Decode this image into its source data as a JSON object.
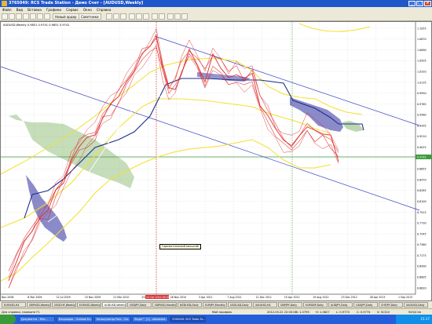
{
  "window": {
    "title": "3765049: RCS Trade Station - Демо Счет - [AUDUSD,Weekly]",
    "buttons": [
      "_",
      "□",
      "×"
    ]
  },
  "menu": [
    "Файл",
    "Вид",
    "Вставка",
    "Графики",
    "Сервис",
    "Окно",
    "Справка"
  ],
  "toolbar": {
    "new_order_label": "Новый ордер",
    "experts_label": "Советники"
  },
  "chart": {
    "indicator_label": "AUDUSD,Weekly  0.9851 0.9741 0.9851 0.9741",
    "price_labels": [
      "1.1055",
      "1.0870",
      "1.0690",
      "1.0505",
      "1.0320",
      "1.0135",
      "0.9950",
      "0.9765",
      "0.9580",
      "0.9395",
      "0.9210",
      "0.9025",
      "0.8840",
      "0.8655",
      "0.8470",
      "0.8285",
      "0.8100",
      "0.7915",
      "0.7730",
      "0.7545",
      "0.7360",
      "0.7175",
      "0.6990",
      "0.6805",
      "0.6620"
    ],
    "date_labels": [
      "9 Nov 2008",
      "8 Mar 2009",
      "12 Jul 2009",
      "15 Nov 2009",
      "21 Mar 2010",
      "25 Jul 2010",
      "28 Nov 2010",
      "3 Apr 2011",
      "7 Aug 2011",
      "11 Dec 2011",
      "15 Apr 2012",
      "19 Aug 2012",
      "23 Dec 2012",
      "28 Apr 2013",
      "1 Sep 2013"
    ],
    "highlight_date": "24 Oct 2010 00:00",
    "current_price": "0.9741",
    "tooltip": "Горизонтальный масштаб"
  },
  "tabs": [
    "EURUSD,H4",
    "GBPUSD,Weekly",
    "USDCHF,Weekly",
    "EURUSD,Weekly",
    "AUDUSD,Weekly",
    "USDJPY,Daily",
    "GBPUSD,Monthly",
    "NZDUSD,Daily",
    "EURJPY,Monthly",
    "USDCAD,Daily",
    "XAUUSD,H4",
    "GBPJPY,Daily",
    "EURGBP,Daily",
    "AUDJPY,Daily",
    "CADJPY,Daily",
    "CHFJPY,Daily",
    "XAGUSD,Daily"
  ],
  "active_tab": 4,
  "status": {
    "help": "Для справки, нажмите F1",
    "profile": "Мой профиль",
    "datetime": "2012.05.22 22:00:00",
    "open": "O: 1.0793",
    "high": "H: 1.0627",
    "low": "L: 0.9770",
    "close": "C: 0.9774",
    "volume": "V: 31310",
    "traffic": "945/4 kb"
  },
  "taskbar": {
    "start": "пуск",
    "items": [
      "Документы - Micr...",
      "Входящие - Outlook Ex...",
      "Калькулятор Росс - Ко...",
      "Skype™ [1] - alexander...",
      "3765049: RCS Trade St..."
    ],
    "active_item": 4,
    "clock": "15:17"
  },
  "colors": {
    "title_bar": "#1f56c9",
    "chart_bg": "#ffffff",
    "price_line": "#dd1e1e",
    "bollinger": "#f2e12d",
    "kijun": "#1d2f8c",
    "cloud_bull": "#5b9e3a",
    "cloud_bear": "#2c2c9e",
    "trendline": "#3a42c4",
    "support_line": "#3c9c3c"
  }
}
